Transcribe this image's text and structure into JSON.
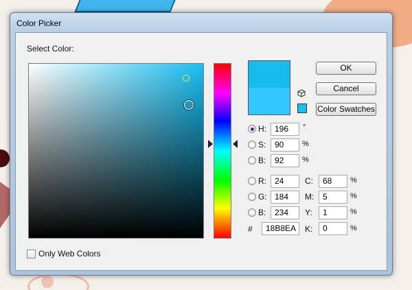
{
  "dialog": {
    "title": "Color Picker",
    "select_label": "Select Color:",
    "only_web_label": "Only Web Colors",
    "only_web_checked": false
  },
  "buttons": {
    "ok": "OK",
    "cancel": "Cancel",
    "swatches": "Color Swatches"
  },
  "preview": {
    "new_color": "#18BBEE",
    "current_color": "#32C8FF"
  },
  "hsb": {
    "h": {
      "label": "H:",
      "value": "196",
      "unit": "°",
      "selected": true
    },
    "s": {
      "label": "S:",
      "value": "90",
      "unit": "%",
      "selected": false
    },
    "b": {
      "label": "B:",
      "value": "92",
      "unit": "%",
      "selected": false
    }
  },
  "rgb": {
    "r": {
      "label": "R:",
      "value": "24"
    },
    "g": {
      "label": "G:",
      "value": "184"
    },
    "b": {
      "label": "B:",
      "value": "234"
    }
  },
  "hex": {
    "label": "#",
    "value": "18B8EA"
  },
  "cmyk": {
    "c": {
      "label": "C:",
      "value": "68",
      "unit": "%"
    },
    "m": {
      "label": "M:",
      "value": "5",
      "unit": "%"
    },
    "y": {
      "label": "Y:",
      "value": "1",
      "unit": "%"
    },
    "k": {
      "label": "K:",
      "value": "0",
      "unit": "%"
    }
  },
  "icons": {
    "out_of_gamut": "cube-icon",
    "web_swatch": "web-color-swatch-icon"
  }
}
